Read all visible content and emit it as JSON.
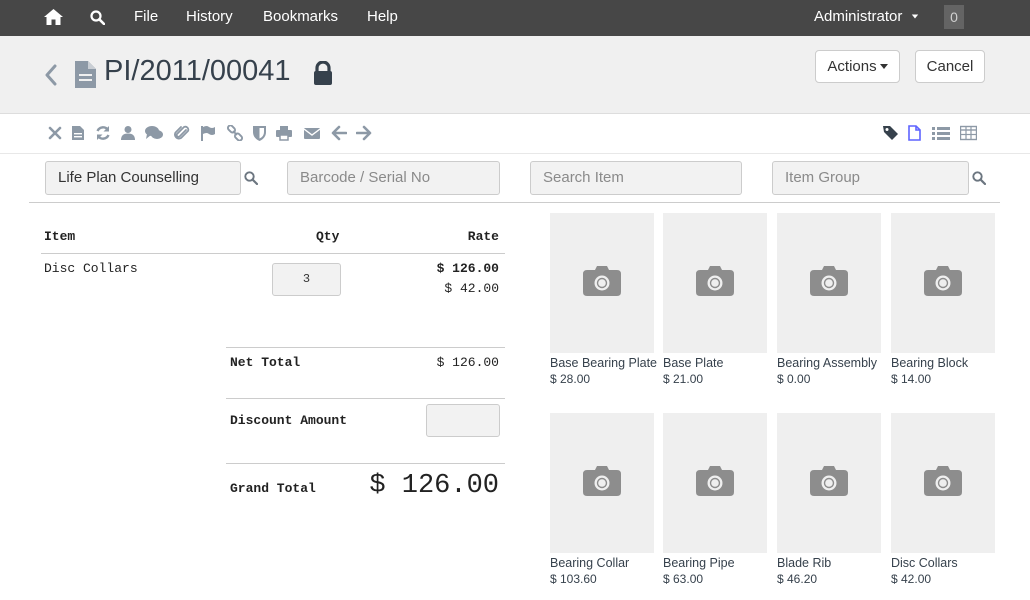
{
  "navbar": {
    "menu": [
      "File",
      "History",
      "Bookmarks",
      "Help"
    ],
    "user": "Administrator",
    "notification_count": "0",
    "icons": [
      "home-icon",
      "search-icon"
    ]
  },
  "header": {
    "title": "PI/2011/00041",
    "actions_label": "Actions",
    "cancel_label": "Cancel"
  },
  "toolbar": {
    "left_icons": [
      "close-icon",
      "file-icon",
      "refresh-icon",
      "user-icon",
      "comment-icon",
      "attachment-icon",
      "flag-icon",
      "link-icon",
      "shield-icon",
      "print-icon",
      "email-icon",
      "arrow-left-icon",
      "arrow-right-icon"
    ],
    "right_icons": [
      "tag-icon",
      "document-icon",
      "list-icon",
      "table-icon"
    ]
  },
  "filters": {
    "customer": "Life Plan Counselling",
    "barcode_placeholder": "Barcode / Serial No",
    "search_placeholder": "Search Item",
    "group_placeholder": "Item Group"
  },
  "cart": {
    "headers": {
      "item": "Item",
      "qty": "Qty",
      "rate": "Rate"
    },
    "items": [
      {
        "name": "Disc Collars",
        "qty": "3",
        "amount": "$ 126.00",
        "rate": "$ 42.00"
      }
    ],
    "net_total_label": "Net Total",
    "net_total": "$ 126.00",
    "discount_label": "Discount Amount",
    "discount_value": "",
    "grand_total_label": "Grand Total",
    "grand_total": "$ 126.00"
  },
  "items": [
    {
      "name": "Base Bearing Plate",
      "price": "$ 28.00"
    },
    {
      "name": "Base Plate",
      "price": "$ 21.00"
    },
    {
      "name": "Bearing Assembly",
      "price": "$ 0.00"
    },
    {
      "name": "Bearing Block",
      "price": "$ 14.00"
    },
    {
      "name": "Bearing Collar",
      "price": "$ 103.60"
    },
    {
      "name": "Bearing Pipe",
      "price": "$ 63.00"
    },
    {
      "name": "Blade Rib",
      "price": "$ 46.20"
    },
    {
      "name": "Disc Collars",
      "price": "$ 42.00"
    }
  ],
  "colors": {
    "navbar": "#474747",
    "header_bg": "#f0f0f0",
    "tile_bg": "#efefef",
    "icon_grey": "#8d99a6",
    "active_blue": "#5e64ff"
  }
}
